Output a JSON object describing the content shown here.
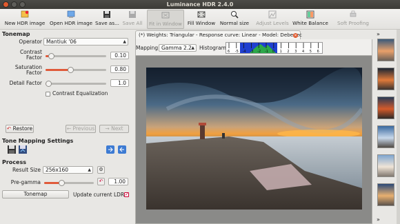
{
  "window": {
    "title": "Luminance HDR 2.4.0"
  },
  "toolbar": {
    "new_hdr": "New HDR image",
    "open_hdr": "Open HDR image",
    "save_as": "Save as...",
    "save_all": "Save All",
    "fit_window": "Fit in Window",
    "fill_window": "Fill Window",
    "normal_size": "Normal size",
    "adjust_levels": "Adjust Levels",
    "white_balance": "White Balance",
    "soft_proofing": "Soft Proofing"
  },
  "tonemap": {
    "heading": "Tonemap",
    "operator_label": "Operator",
    "operator_value": "Mantiuk '06",
    "contrast_label_1": "Contrast",
    "contrast_label_2": "Factor",
    "contrast_value": "0.10",
    "contrast_fraction": 0.05,
    "saturation_label_1": "Saturation",
    "saturation_label_2": "Factor",
    "saturation_value": "0.80",
    "saturation_fraction": 0.4,
    "detail_label": "Detail Factor",
    "detail_value": "1.0",
    "detail_fraction": 0.0,
    "equalization_label": "Contrast Equalization",
    "equalization_checked": false,
    "restore_label": "Restore",
    "previous_label": "Previous",
    "next_label": "Next"
  },
  "settings": {
    "heading": "Tone Mapping Settings"
  },
  "process": {
    "heading": "Process",
    "result_size_label": "Result Size",
    "result_size_value": "256x160",
    "pregamma_label": "Pre-gamma",
    "pregamma_value": "1.00",
    "pregamma_fraction": 0.33,
    "tonemap_button": "Tonemap",
    "update_ldr_label": "Update current LDR",
    "update_ldr_checked": true
  },
  "viewer": {
    "tab_title": "(*) Weights: Triangular - Response curve: Linear - Model: Debevec",
    "mapping_label": "Mapping:",
    "mapping_value": "Gamma 2.2",
    "histogram_label": "Histogram:",
    "histogram_ticks": [
      "6",
      "-5",
      "-4",
      "-3",
      "-2",
      "-1",
      "0",
      "1",
      "2",
      "3",
      "4",
      "5",
      "6"
    ]
  },
  "colors": {
    "accent": "#e05a3a",
    "histogram_blue": "#1f3fd0",
    "histogram_green": "#2da84a"
  },
  "thumbnails": {
    "count": 6
  }
}
